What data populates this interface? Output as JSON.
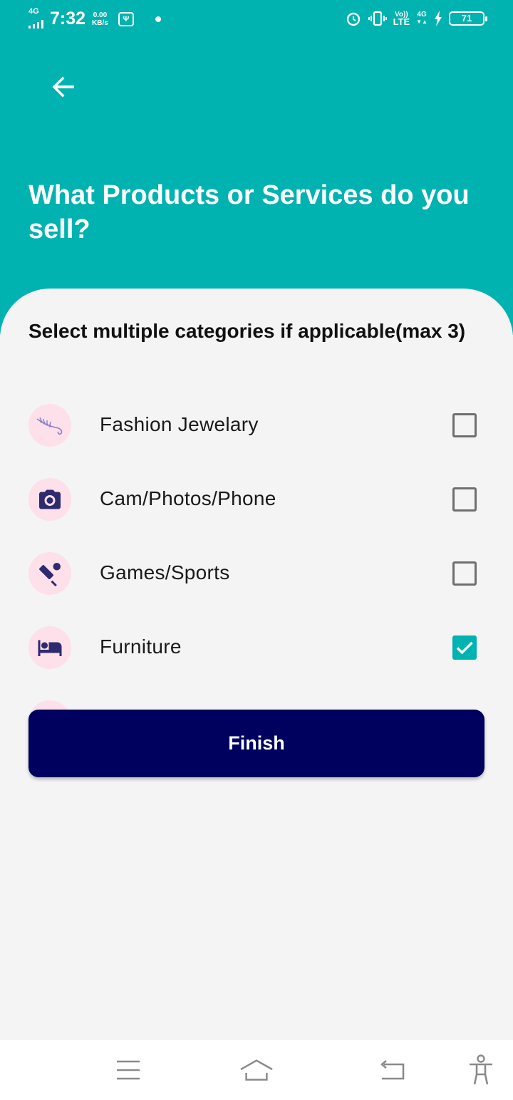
{
  "status_bar": {
    "network": "4G",
    "time": "7:32",
    "speed_value": "0.00",
    "speed_unit": "KB/s",
    "volte_top": "Vo))",
    "volte_bottom": "LTE",
    "data_type": "4G",
    "battery": "71"
  },
  "header": {
    "title": "What Products or Services do you sell?"
  },
  "content": {
    "subtitle": "Select multiple categories if applicable(max 3)",
    "categories": [
      {
        "label": "Fashion Jewelary",
        "icon": "jewelry-icon",
        "checked": false
      },
      {
        "label": "Cam/Photos/Phone",
        "icon": "camera-icon",
        "checked": false
      },
      {
        "label": "Games/Sports",
        "icon": "sports-icon",
        "checked": false
      },
      {
        "label": "Furniture",
        "icon": "bed-icon",
        "checked": true
      }
    ],
    "finish_label": "Finish"
  },
  "colors": {
    "accent": "#00b2b0",
    "primary_button": "#00005e",
    "icon_bg": "#fde0ea",
    "icon_fg": "#2e2a6e"
  }
}
